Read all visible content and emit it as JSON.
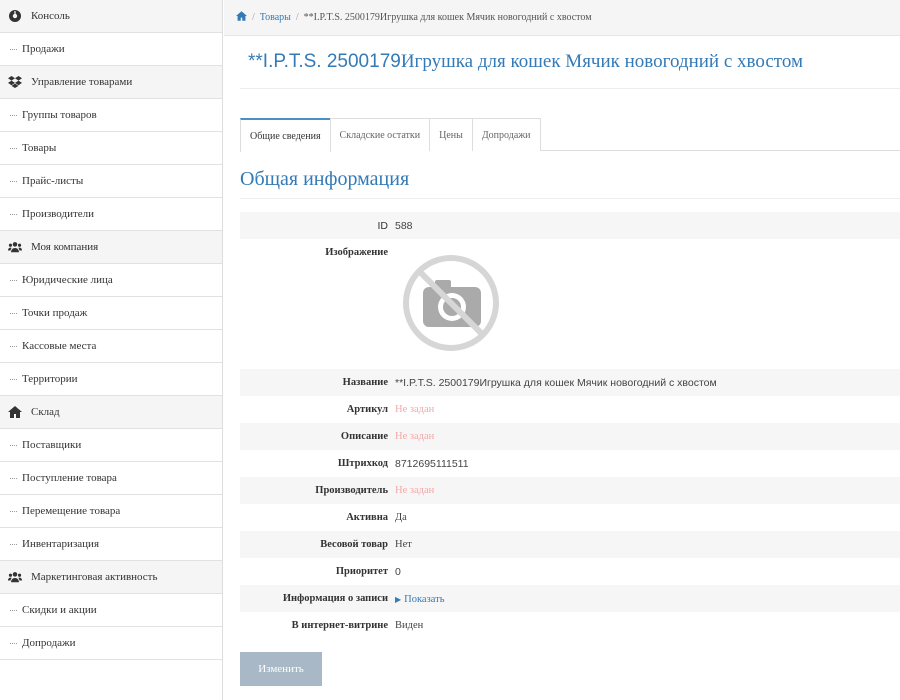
{
  "sidebar": {
    "items": [
      {
        "type": "group",
        "label": "Консоль",
        "icon": "dashboard-icon"
      },
      {
        "type": "sub",
        "label": "Продажи"
      },
      {
        "type": "group",
        "label": "Управление товарами",
        "icon": "dropbox-icon"
      },
      {
        "type": "sub",
        "label": "Группы товаров"
      },
      {
        "type": "sub",
        "label": "Товары"
      },
      {
        "type": "sub",
        "label": "Прайс-листы"
      },
      {
        "type": "sub",
        "label": "Производители"
      },
      {
        "type": "group",
        "label": "Моя компания",
        "icon": "users-icon"
      },
      {
        "type": "sub",
        "label": "Юридические лица"
      },
      {
        "type": "sub",
        "label": "Точки продаж"
      },
      {
        "type": "sub",
        "label": "Кассовые места"
      },
      {
        "type": "sub",
        "label": "Территории"
      },
      {
        "type": "group",
        "label": "Склад",
        "icon": "home-icon"
      },
      {
        "type": "sub",
        "label": "Поставщики"
      },
      {
        "type": "sub",
        "label": "Поступление товара"
      },
      {
        "type": "sub",
        "label": "Перемещение товара"
      },
      {
        "type": "sub",
        "label": "Инвентаризация"
      },
      {
        "type": "group",
        "label": "Маркетинговая активность",
        "icon": "users-icon"
      },
      {
        "type": "sub",
        "label": "Скидки и акции"
      },
      {
        "type": "sub",
        "label": "Допродажи"
      }
    ]
  },
  "breadcrumb": {
    "home_icon": "home-icon",
    "separator": "/",
    "link": "Товары",
    "current": "**I.P.T.S. 2500179Игрушка для кошек Мячик новогодний с хвостом"
  },
  "title": {
    "part1": "**I.P.T.S. 2500179",
    "part2": "Игрушка для кошек Мячик новогодний с хвостом"
  },
  "tabs": [
    {
      "label": "Общие сведения",
      "active": true
    },
    {
      "label": "Складские остатки",
      "active": false
    },
    {
      "label": "Цены",
      "active": false
    },
    {
      "label": "Допродажи",
      "active": false
    }
  ],
  "section_title": "Общая информация",
  "props": {
    "id": {
      "label": "ID",
      "value": "588"
    },
    "image": {
      "label": "Изображение",
      "icon": "no-photo-icon"
    },
    "name": {
      "label": "Название",
      "value": "**I.P.T.S. 2500179Игрушка для кошек Мячик новогодний с хвостом"
    },
    "article": {
      "label": "Артикул",
      "value": "Не задан"
    },
    "description": {
      "label": "Описание",
      "value": "Не задан"
    },
    "barcode": {
      "label": "Штрихкод",
      "value": "8712695111511"
    },
    "manufacturer": {
      "label": "Производитель",
      "value": "Не задан"
    },
    "active": {
      "label": "Активна",
      "value": "Да"
    },
    "weight": {
      "label": "Весовой товар",
      "value": "Нет"
    },
    "priority": {
      "label": "Приоритет",
      "value": "0"
    },
    "record_info": {
      "label": "Информация о записи",
      "link": "Показать"
    },
    "showcase": {
      "label": "В интернет-витрине",
      "value": "Виден"
    }
  },
  "edit_button": "Изменить",
  "colors": {
    "accent": "#337ab7",
    "empty_value": "#f4a7a7",
    "button": "#a9b8c6"
  }
}
